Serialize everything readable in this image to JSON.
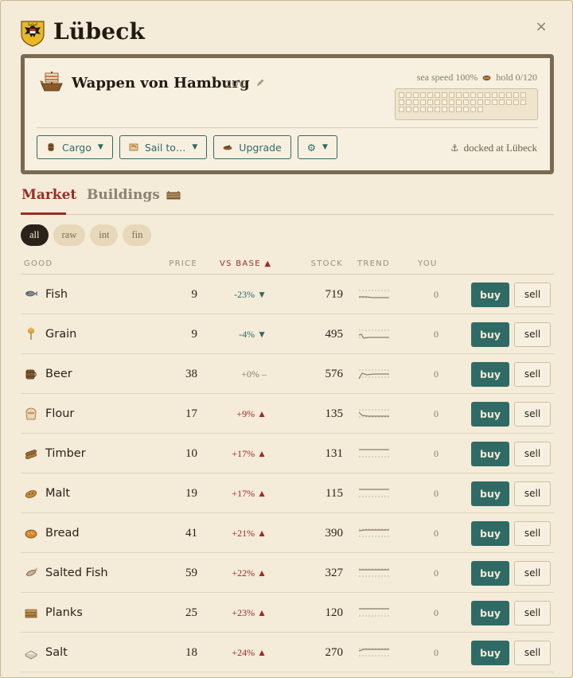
{
  "city": {
    "title": "Lübeck"
  },
  "close_label": "×",
  "ship": {
    "name": "Wappen von Hamburg",
    "class": "COG",
    "sea_speed": "sea speed 100%",
    "hold": "hold 0/120",
    "docked": "docked at Lübeck",
    "anchor_glyph": "⚓",
    "hold_slots": 48,
    "hold_used": 0
  },
  "actions": {
    "cargo": "Cargo",
    "sail": "Sail to…",
    "upgrade": "Upgrade",
    "settings_glyph": "⚙",
    "caret": "▼"
  },
  "tabs": {
    "market": "Market",
    "buildings": "Buildings"
  },
  "filters": [
    "all",
    "raw",
    "int",
    "fin"
  ],
  "columns": {
    "good": "GOOD",
    "price": "PRICE",
    "vs_base": "VS BASE ▲",
    "stock": "STOCK",
    "trend": "TREND",
    "you": "YOU"
  },
  "buy_label": "buy",
  "sell_label": "sell",
  "goods": [
    {
      "name": "Fish",
      "icon": "fish-icon",
      "price": "9",
      "vs": "-23%",
      "dir": "down",
      "stock": "719",
      "you": "0"
    },
    {
      "name": "Grain",
      "icon": "grain-icon",
      "price": "9",
      "vs": "-4%",
      "dir": "down",
      "stock": "495",
      "you": "0"
    },
    {
      "name": "Beer",
      "icon": "beer-icon",
      "price": "38",
      "vs": "+0%",
      "dir": "flat",
      "stock": "576",
      "you": "0"
    },
    {
      "name": "Flour",
      "icon": "flour-icon",
      "price": "17",
      "vs": "+9%",
      "dir": "up",
      "stock": "135",
      "you": "0"
    },
    {
      "name": "Timber",
      "icon": "timber-icon",
      "price": "10",
      "vs": "+17%",
      "dir": "up",
      "stock": "131",
      "you": "0"
    },
    {
      "name": "Malt",
      "icon": "malt-icon",
      "price": "19",
      "vs": "+17%",
      "dir": "up",
      "stock": "115",
      "you": "0"
    },
    {
      "name": "Bread",
      "icon": "bread-icon",
      "price": "41",
      "vs": "+21%",
      "dir": "up",
      "stock": "390",
      "you": "0"
    },
    {
      "name": "Salted Fish",
      "icon": "salted-fish-icon",
      "price": "59",
      "vs": "+22%",
      "dir": "up",
      "stock": "327",
      "you": "0"
    },
    {
      "name": "Planks",
      "icon": "planks-icon",
      "price": "25",
      "vs": "+23%",
      "dir": "up",
      "stock": "120",
      "you": "0"
    },
    {
      "name": "Salt",
      "icon": "salt-icon",
      "price": "18",
      "vs": "+24%",
      "dir": "up",
      "stock": "270",
      "you": "0"
    }
  ],
  "colors": {
    "accent_red": "#9b2c24",
    "accent_teal": "#2f6b64",
    "background": "#f4ebd9",
    "ship_frame": "#7a6a52"
  }
}
